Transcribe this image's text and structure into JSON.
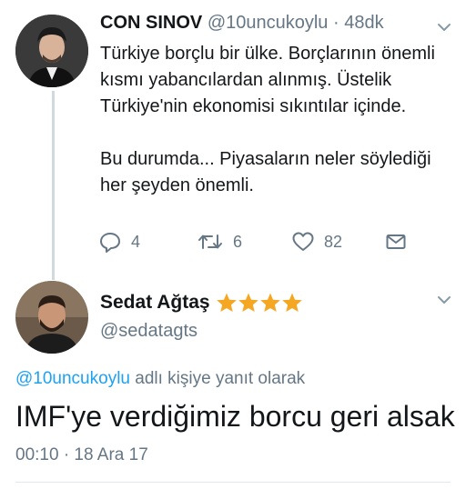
{
  "tweet1": {
    "display_name": "CON SINOV",
    "handle": "@10uncukoylu",
    "separator": "·",
    "time": "48dk",
    "text_paragraph1": "Türkiye borçlu bir ülke. Borçlarının önemli kısmı yabancılardan alınmış. Üstelik Türkiye'nin ekonomisi sıkıntılar içinde.",
    "text_paragraph2": "Bu durumda... Piyasaların neler söylediği her şeyden önemli.",
    "actions": {
      "reply_count": "4",
      "retweet_count": "6",
      "like_count": "82"
    }
  },
  "tweet2": {
    "display_name": "Sedat Ağtaş",
    "handle": "@sedatagts",
    "badge_star_count": 4,
    "replying_mention": "@10uncukoylu",
    "replying_suffix": " adlı kişiye yanıt olarak",
    "text": "IMF'ye verdiğimiz borcu geri alsak",
    "timestamp": "00:10 · 18 Ara 17"
  },
  "colors": {
    "text": "#14171a",
    "secondary": "#657786",
    "link": "#1da1f2",
    "star": "#f5a623",
    "thread_line": "#cfd9de"
  },
  "icons": {
    "reply": "reply-icon",
    "retweet": "retweet-icon",
    "like": "heart-icon",
    "dm": "envelope-icon",
    "menu": "chevron-down-icon",
    "badge": "star-icon"
  }
}
